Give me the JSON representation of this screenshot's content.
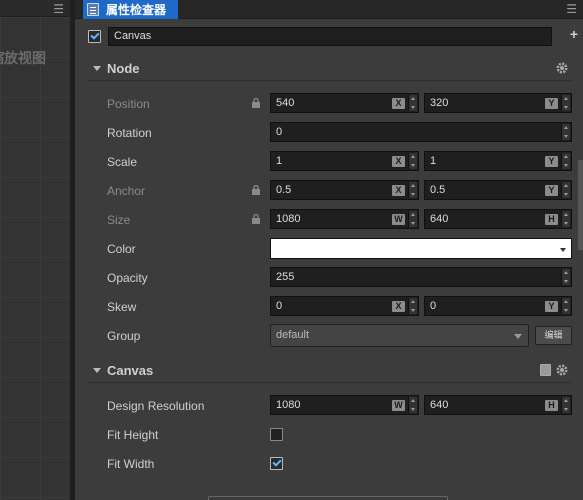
{
  "scene_panel": {
    "title": "缩放视图",
    "menu_icon": "hamburger-icon"
  },
  "inspector": {
    "tab_label": "属性检查器",
    "tab_icon": "inspector-icon",
    "menu_icon": "hamburger-icon",
    "node_enabled": true,
    "node_name": "Canvas",
    "add_component_icon": "plus-icon"
  },
  "node_section": {
    "title": "Node",
    "settings_icon": "gear-icon",
    "position": {
      "label": "Position",
      "x": "540",
      "y": "320",
      "x_axis": "X",
      "y_axis": "Y"
    },
    "rotation": {
      "label": "Rotation",
      "value": "0"
    },
    "scale": {
      "label": "Scale",
      "x": "1",
      "y": "1",
      "x_axis": "X",
      "y_axis": "Y"
    },
    "anchor": {
      "label": "Anchor",
      "x": "0.5",
      "y": "0.5",
      "x_axis": "X",
      "y_axis": "Y"
    },
    "size": {
      "label": "Size",
      "w": "1080",
      "h": "640",
      "w_axis": "W",
      "h_axis": "H"
    },
    "color": {
      "label": "Color",
      "value": "#ffffff"
    },
    "opacity": {
      "label": "Opacity",
      "value": "255"
    },
    "skew": {
      "label": "Skew",
      "x": "0",
      "y": "0",
      "x_axis": "X",
      "y_axis": "Y"
    },
    "group": {
      "label": "Group",
      "value": "default",
      "edit_label": "编辑"
    }
  },
  "canvas_section": {
    "title": "Canvas",
    "help_icon": "book-icon",
    "settings_icon": "gear-icon",
    "design_resolution": {
      "label": "Design Resolution",
      "w": "1080",
      "h": "640",
      "w_axis": "W",
      "h_axis": "H"
    },
    "fit_height": {
      "label": "Fit Height",
      "checked": false
    },
    "fit_width": {
      "label": "Fit Width",
      "checked": true
    }
  },
  "colors": {
    "accent": "#1f69c8",
    "panel": "#3c3c3c",
    "input": "#1f1f1f"
  }
}
